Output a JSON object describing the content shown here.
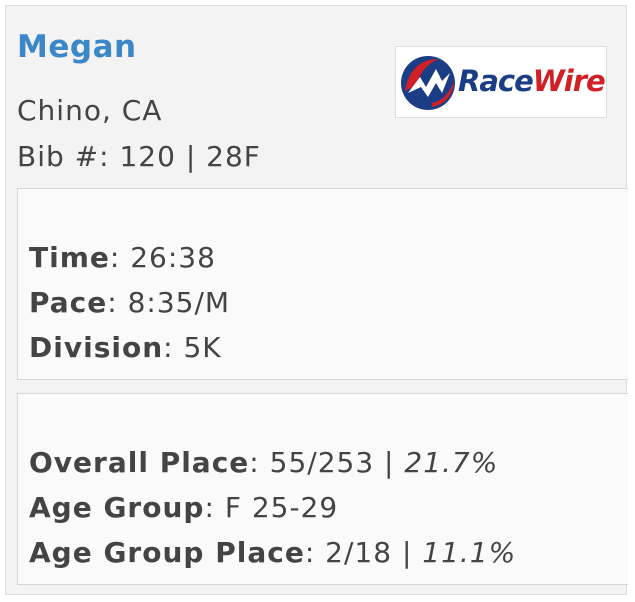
{
  "athlete": {
    "name": "Megan",
    "location": "Chino, CA",
    "bib_label": "Bib #:",
    "bib_value": "120 | 28F"
  },
  "logo": {
    "text_race": "Race",
    "text_wire": "Wire",
    "colors": {
      "blue": "#1b3d85",
      "red": "#d11f26"
    }
  },
  "result": {
    "time_label": "Time",
    "time_value": "26:38",
    "pace_label": "Pace",
    "pace_value": "8:35/M",
    "division_label": "Division",
    "division_value": "5K"
  },
  "placement": {
    "overall_label": "Overall Place",
    "overall_value": "55/253",
    "overall_sep": " | ",
    "overall_pct": "21.7%",
    "age_group_label": "Age Group",
    "age_group_value": "F 25-29",
    "ag_place_label": "Age Group Place",
    "ag_place_value": "2/18",
    "ag_place_sep": " | ",
    "ag_place_pct": "11.1%"
  },
  "colors": {
    "name": "#3b87c7",
    "text": "#444444",
    "card_bg": "#f3f3f3",
    "panel_bg": "#fafafa"
  }
}
